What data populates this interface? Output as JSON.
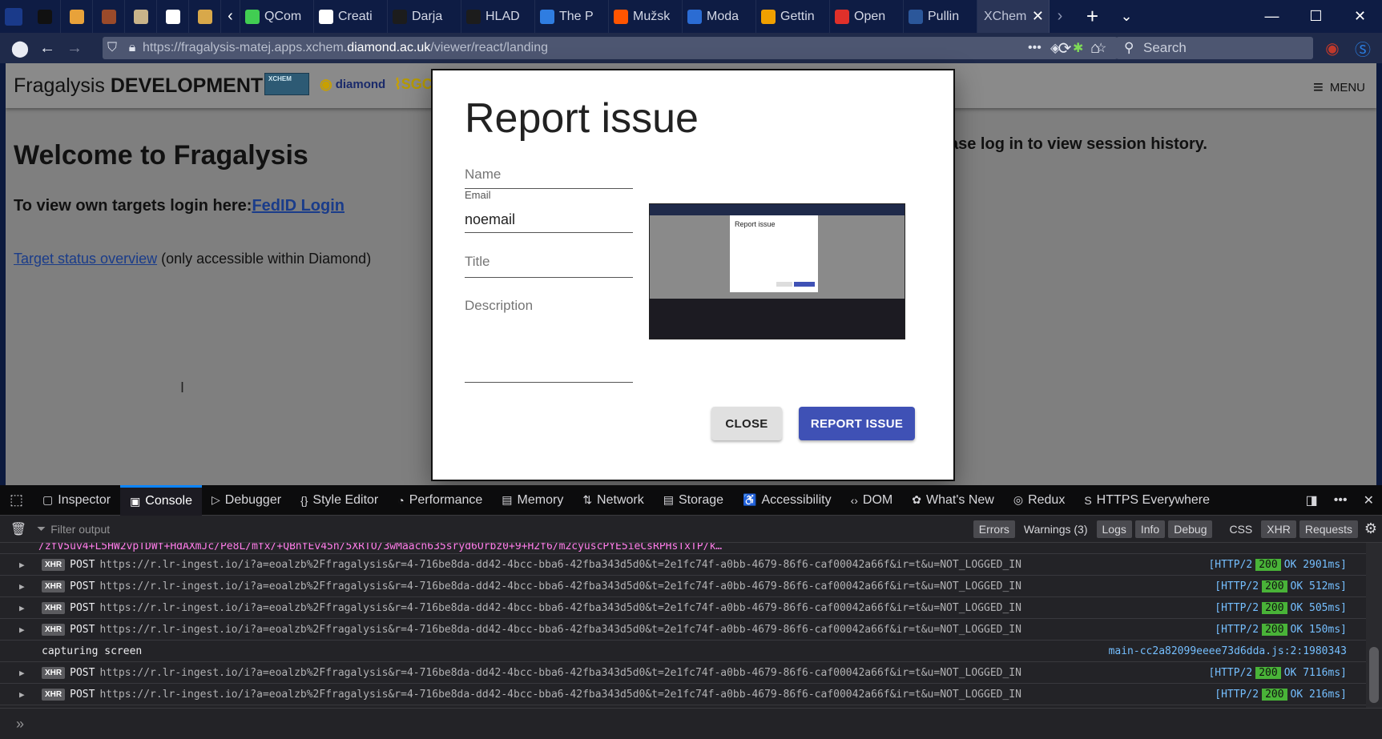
{
  "browser": {
    "tabs": [
      {
        "label": "",
        "color": "#111111"
      },
      {
        "label": "",
        "color": "#e8a23a"
      },
      {
        "label": "",
        "color": "#9a4a2a"
      },
      {
        "label": "",
        "color": "#c9b48a"
      },
      {
        "label": "",
        "color": "#ffffff"
      },
      {
        "label": "",
        "color": "#d8a84a"
      }
    ],
    "named_tabs": [
      {
        "label": "QCom",
        "color": "#41cd52"
      },
      {
        "label": "Creati",
        "color": "#ffffff"
      },
      {
        "label": "Darja",
        "color": "#1c1c1c"
      },
      {
        "label": "HLAD",
        "color": "#1c1c1c"
      },
      {
        "label": "The P",
        "color": "#2f7de1"
      },
      {
        "label": "Mužsk",
        "color": "#ff5500"
      },
      {
        "label": "Moda",
        "color": "#2b6cd3"
      },
      {
        "label": "Gettin",
        "color": "#f0a000"
      },
      {
        "label": "Open",
        "color": "#e0302a"
      },
      {
        "label": "Pullin",
        "color": "#2b579a"
      },
      {
        "label": "XChem",
        "color": "#2a3557"
      }
    ],
    "url_prefix": "https://fragalysis-matej.apps.xchem.",
    "url_host": "diamond.ac.uk",
    "url_path": "/viewer/react/landing",
    "search_placeholder": "Search"
  },
  "page": {
    "brand_prefix": "Fragalysis ",
    "brand_suffix": "DEVELOPMENT",
    "logo_xchem": "XCHEM",
    "logo_diamond": "diamond",
    "logo_sgc": "SGC",
    "menu_label": "MENU",
    "welcome": "Welcome to Fragalysis",
    "login_prefix": "To view own targets login here:",
    "login_link": "FedID Login",
    "status_link": "Target status overview",
    "status_suffix": " (only accessible within Diamond)",
    "session_text": "ase log in to view session history."
  },
  "dialog": {
    "title": "Report issue",
    "name_label": "Name",
    "email_label": "Email",
    "email_value": "noemail",
    "title_label": "Title",
    "description_label": "Description",
    "close_label": "CLOSE",
    "report_label": "REPORT ISSUE",
    "thumb_title": "Report issue"
  },
  "devtools": {
    "tabs": [
      "Inspector",
      "Console",
      "Debugger",
      "Style Editor",
      "Performance",
      "Memory",
      "Network",
      "Storage",
      "Accessibility",
      "DOM",
      "What's New",
      "Redux",
      "HTTPS Everywhere"
    ],
    "filter_placeholder": "Filter output",
    "filters": [
      "Errors",
      "Warnings (3)",
      "Logs",
      "Info",
      "Debug",
      "CSS",
      "XHR",
      "Requests"
    ],
    "truncated_line": "/zfV5uv4+L5HW2vpTDWf+HdAXmJc/Pe8L/mfx/+QBnfEv45n/5XRTO/3wMaacn635sryd6Orbz0+9+H2f6/m2cyuscPYE5ieCsRPHsTxTP/k…",
    "rows": [
      {
        "kind": "xhr",
        "method": "POST",
        "url": "https://r.lr-ingest.io/i?a=eoalzb%2Ffragalysis&r=4-716be8da-dd42-4bcc-bba6-42fba343d5d0&t=2e1fc74f-a0bb-4679-86f6-caf00042a66f&ir=t&u=NOT_LOGGED_IN",
        "proto": "[HTTP/2",
        "code": "200",
        "status": "OK 2901ms]"
      },
      {
        "kind": "xhr",
        "method": "POST",
        "url": "https://r.lr-ingest.io/i?a=eoalzb%2Ffragalysis&r=4-716be8da-dd42-4bcc-bba6-42fba343d5d0&t=2e1fc74f-a0bb-4679-86f6-caf00042a66f&ir=t&u=NOT_LOGGED_IN",
        "proto": "[HTTP/2",
        "code": "200",
        "status": "OK 512ms]"
      },
      {
        "kind": "xhr",
        "method": "POST",
        "url": "https://r.lr-ingest.io/i?a=eoalzb%2Ffragalysis&r=4-716be8da-dd42-4bcc-bba6-42fba343d5d0&t=2e1fc74f-a0bb-4679-86f6-caf00042a66f&ir=t&u=NOT_LOGGED_IN",
        "proto": "[HTTP/2",
        "code": "200",
        "status": "OK 505ms]"
      },
      {
        "kind": "xhr",
        "method": "POST",
        "url": "https://r.lr-ingest.io/i?a=eoalzb%2Ffragalysis&r=4-716be8da-dd42-4bcc-bba6-42fba343d5d0&t=2e1fc74f-a0bb-4679-86f6-caf00042a66f&ir=t&u=NOT_LOGGED_IN",
        "proto": "[HTTP/2",
        "code": "200",
        "status": "OK 150ms]"
      },
      {
        "kind": "log",
        "text": "capturing screen",
        "source": "main-cc2a82099eeee73d6dda.js:2:1980343"
      },
      {
        "kind": "xhr",
        "method": "POST",
        "url": "https://r.lr-ingest.io/i?a=eoalzb%2Ffragalysis&r=4-716be8da-dd42-4bcc-bba6-42fba343d5d0&t=2e1fc74f-a0bb-4679-86f6-caf00042a66f&ir=t&u=NOT_LOGGED_IN",
        "proto": "[HTTP/2",
        "code": "200",
        "status": "OK 7116ms]"
      },
      {
        "kind": "xhr",
        "method": "POST",
        "url": "https://r.lr-ingest.io/i?a=eoalzb%2Ffragalysis&r=4-716be8da-dd42-4bcc-bba6-42fba343d5d0&t=2e1fc74f-a0bb-4679-86f6-caf00042a66f&ir=t&u=NOT_LOGGED_IN",
        "proto": "[HTTP/2",
        "code": "200",
        "status": "OK 216ms]"
      }
    ]
  },
  "colors": {
    "accent": "#3f51b5",
    "active_devtools_tab": "#0a84ff",
    "status_ok": "#49b338"
  }
}
